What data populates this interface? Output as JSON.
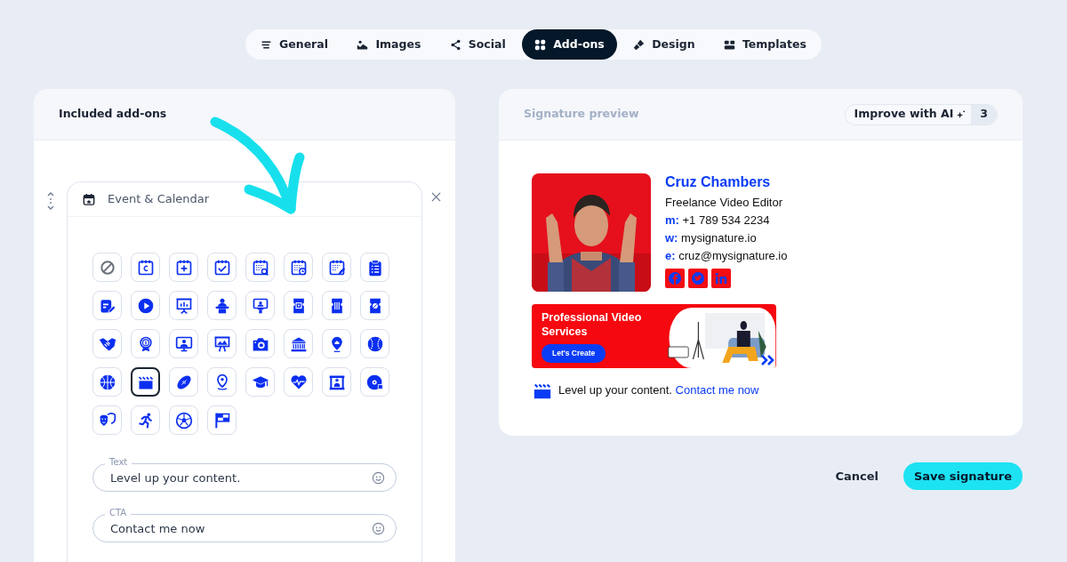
{
  "tabs": [
    {
      "label": "General",
      "selected": false
    },
    {
      "label": "Images",
      "selected": false
    },
    {
      "label": "Social",
      "selected": false
    },
    {
      "label": "Add-ons",
      "selected": true
    },
    {
      "label": "Design",
      "selected": false
    },
    {
      "label": "Templates",
      "selected": false
    }
  ],
  "addons_panel": {
    "title": "Included add-ons",
    "addon": {
      "title": "Event & Calendar",
      "icons": [
        {
          "selected": false
        },
        {
          "selected": false
        },
        {
          "selected": false
        },
        {
          "selected": false
        },
        {
          "selected": false
        },
        {
          "selected": false
        },
        {
          "selected": false
        },
        {
          "selected": false
        },
        {
          "selected": false
        },
        {
          "selected": false
        },
        {
          "selected": false
        },
        {
          "selected": false
        },
        {
          "selected": false
        },
        {
          "selected": false
        },
        {
          "selected": false
        },
        {
          "selected": false
        },
        {
          "selected": false
        },
        {
          "selected": false
        },
        {
          "selected": false
        },
        {
          "selected": false
        },
        {
          "selected": false
        },
        {
          "selected": false
        },
        {
          "selected": false
        },
        {
          "selected": false
        },
        {
          "selected": false
        },
        {
          "selected": true
        },
        {
          "selected": false
        },
        {
          "selected": false
        },
        {
          "selected": false
        },
        {
          "selected": false
        },
        {
          "selected": false
        },
        {
          "selected": false
        },
        {
          "selected": false
        },
        {
          "selected": false
        },
        {
          "selected": false
        },
        {
          "selected": false
        }
      ],
      "fields": [
        {
          "label": "Text",
          "value": "Level up your content."
        },
        {
          "label": "CTA",
          "value": "Contact me now"
        }
      ]
    }
  },
  "preview": {
    "title": "Signature preview",
    "ai_button": {
      "label": "Improve with AI",
      "count": "3"
    },
    "signature": {
      "name": "Cruz Chambers",
      "role": "Freelance Video Editor",
      "contacts": [
        {
          "prefix": "m:",
          "value": "+1 789 534 2234"
        },
        {
          "prefix": "w:",
          "value": "mysignature.io"
        },
        {
          "prefix": "e:",
          "value": "cruz@mysignature.io"
        }
      ],
      "banner": {
        "title": "Professional Video Services",
        "button": "Let's Create"
      },
      "addon_line": {
        "text": "Level up your content.",
        "link": "Contact me now"
      }
    }
  },
  "actions": {
    "cancel": "Cancel",
    "save": "Save signature"
  }
}
